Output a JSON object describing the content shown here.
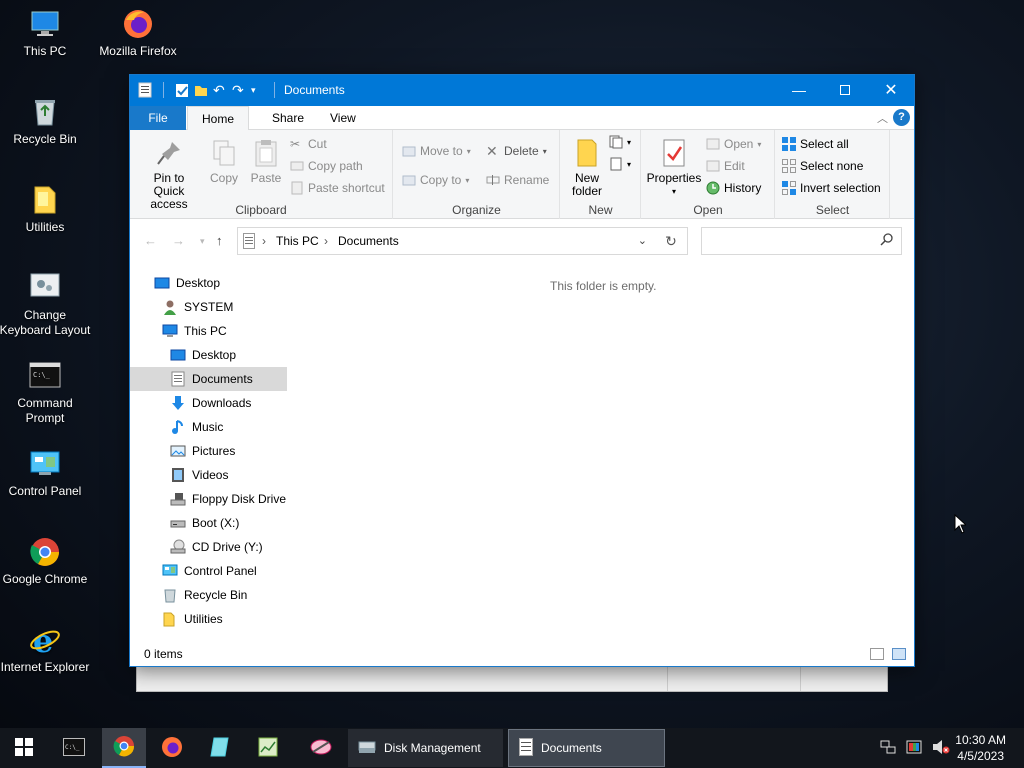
{
  "desktop": {
    "icons": [
      {
        "label": "This PC"
      },
      {
        "label": "Mozilla Firefox"
      },
      {
        "label": "Recycle Bin"
      },
      {
        "label": "Utilities"
      },
      {
        "label": "Change Keyboard Layout"
      },
      {
        "label": "Command Prompt"
      },
      {
        "label": "Control Panel"
      },
      {
        "label": "Google Chrome"
      },
      {
        "label": "Internet Explorer"
      }
    ]
  },
  "window": {
    "title": "Documents",
    "tabs": {
      "file": "File",
      "home": "Home",
      "share": "Share",
      "view": "View"
    },
    "ribbon": {
      "clipboard": {
        "label": "Clipboard",
        "pin": "Pin to Quick access",
        "copy": "Copy",
        "paste": "Paste",
        "cut": "Cut",
        "copy_path": "Copy path",
        "paste_shortcut": "Paste shortcut"
      },
      "organize": {
        "label": "Organize",
        "move_to": "Move to",
        "copy_to": "Copy to",
        "delete": "Delete",
        "rename": "Rename"
      },
      "new": {
        "label": "New",
        "new_folder": "New folder"
      },
      "open": {
        "label": "Open",
        "properties": "Properties",
        "open": "Open",
        "edit": "Edit",
        "history": "History"
      },
      "select": {
        "label": "Select",
        "select_all": "Select all",
        "select_none": "Select none",
        "invert": "Invert selection"
      }
    },
    "address": {
      "crumb1": "This PC",
      "crumb2": "Documents"
    },
    "nav": [
      {
        "label": "Desktop"
      },
      {
        "label": "SYSTEM"
      },
      {
        "label": "This PC"
      },
      {
        "label": "Desktop"
      },
      {
        "label": "Documents"
      },
      {
        "label": "Downloads"
      },
      {
        "label": "Music"
      },
      {
        "label": "Pictures"
      },
      {
        "label": "Videos"
      },
      {
        "label": "Floppy Disk Drive"
      },
      {
        "label": "Boot (X:)"
      },
      {
        "label": "CD Drive (Y:)"
      },
      {
        "label": "Control Panel"
      },
      {
        "label": "Recycle Bin"
      },
      {
        "label": "Utilities"
      }
    ],
    "empty_message": "This folder is empty.",
    "status": "0 items"
  },
  "taskbar": {
    "tasks": [
      {
        "label": "Disk Management"
      },
      {
        "label": "Documents"
      }
    ],
    "clock": {
      "time": "10:30 AM",
      "date": "4/5/2023"
    }
  },
  "colors": {
    "accent": "#0078d7",
    "taskbar": "#12161c"
  }
}
